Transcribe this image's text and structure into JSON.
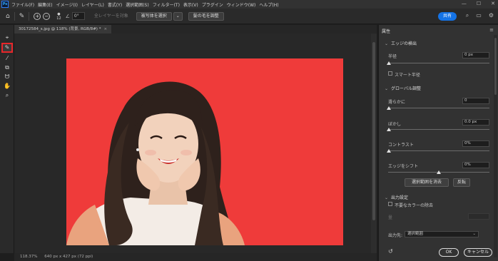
{
  "menubar": {
    "logo": "Ps",
    "items": [
      "ファイル(F)",
      "編集(E)",
      "イメージ(I)",
      "レイヤー(L)",
      "書式(Y)",
      "選択範囲(S)",
      "フィルター(T)",
      "表示(V)",
      "プラグイン",
      "ウィンドウ(W)",
      "ヘルプ(H)"
    ]
  },
  "options": {
    "size": "12",
    "angle": "0°",
    "sample_all_layers": "全レイヤーを対象",
    "select_subject": "被写体を選択",
    "refine_hair": "髪の毛を調整",
    "share": "共有"
  },
  "document": {
    "tab_title": "30172584_s.jpg @ 118% (背景, RGB/8#) *",
    "status_zoom": "118.37%",
    "status_size": "640 px x 427 px (72 ppi)"
  },
  "panel": {
    "title": "属性",
    "edge_detection": "エッジの検出",
    "radius_label": "半径",
    "radius_value": "0 px",
    "smart_radius": "スマート半径",
    "global_refinements": "グローバル調整",
    "smooth_label": "滑らかに",
    "smooth_value": "0",
    "feather_label": "ぼかし",
    "feather_value": "0.0 px",
    "contrast_label": "コントラスト",
    "contrast_value": "0%",
    "shift_edge_label": "エッジをシフト",
    "shift_edge_value": "0%",
    "clear_selection": "選択範囲を消去",
    "invert": "反転",
    "output_settings": "出力設定",
    "decontaminate": "不要なカラーの除去",
    "amount_label": "量",
    "output_to_label": "出力先:",
    "output_to_value": "選択範囲",
    "ok": "OK",
    "cancel": "キャンセル"
  },
  "colors": {
    "accent": "#1473e6",
    "highlight": "#e8262a",
    "backdrop": "#ef3b3a"
  }
}
